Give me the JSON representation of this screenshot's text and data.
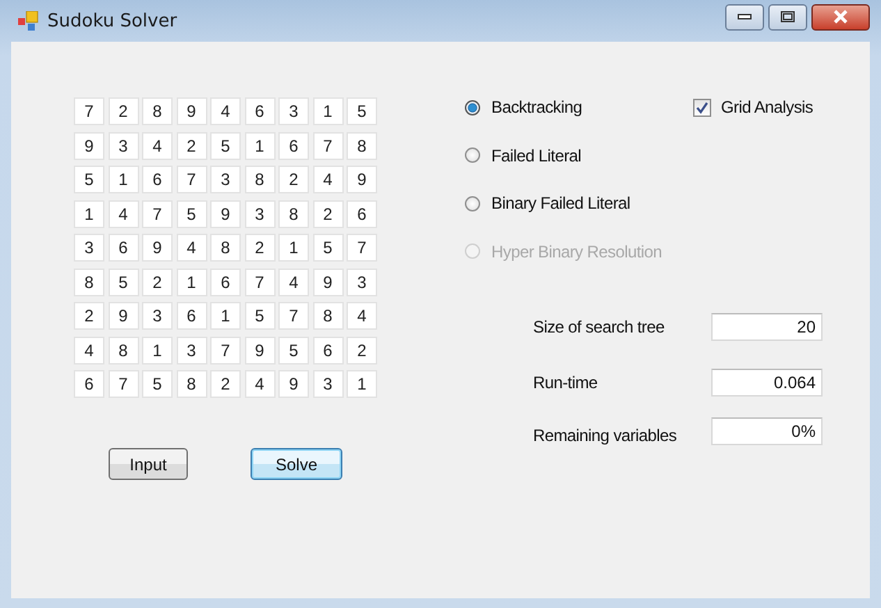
{
  "window": {
    "title": "Sudoku Solver"
  },
  "grid": [
    [
      "7",
      "2",
      "8",
      "9",
      "4",
      "6",
      "3",
      "1",
      "5"
    ],
    [
      "9",
      "3",
      "4",
      "2",
      "5",
      "1",
      "6",
      "7",
      "8"
    ],
    [
      "5",
      "1",
      "6",
      "7",
      "3",
      "8",
      "2",
      "4",
      "9"
    ],
    [
      "1",
      "4",
      "7",
      "5",
      "9",
      "3",
      "8",
      "2",
      "6"
    ],
    [
      "3",
      "6",
      "9",
      "4",
      "8",
      "2",
      "1",
      "5",
      "7"
    ],
    [
      "8",
      "5",
      "2",
      "1",
      "6",
      "7",
      "4",
      "9",
      "3"
    ],
    [
      "2",
      "9",
      "3",
      "6",
      "1",
      "5",
      "7",
      "8",
      "4"
    ],
    [
      "4",
      "8",
      "1",
      "3",
      "7",
      "9",
      "5",
      "6",
      "2"
    ],
    [
      "6",
      "7",
      "5",
      "8",
      "2",
      "4",
      "9",
      "3",
      "1"
    ]
  ],
  "buttons": [
    {
      "label": "Input",
      "focused": false
    },
    {
      "label": "Solve",
      "focused": true
    }
  ],
  "methods": [
    {
      "label": "Backtracking",
      "selected": true,
      "disabled": false
    },
    {
      "label": "Failed Literal",
      "selected": false,
      "disabled": false
    },
    {
      "label": "Binary Failed Literal",
      "selected": false,
      "disabled": false
    },
    {
      "label": "Hyper Binary Resolution",
      "selected": false,
      "disabled": true
    }
  ],
  "grid_analysis": {
    "label": "Grid Analysis",
    "checked": true
  },
  "stats": [
    {
      "label": "Size of search tree",
      "value": "20"
    },
    {
      "label": "Run-time",
      "value": "0.064"
    },
    {
      "label": "Remaining variables",
      "value": "0%"
    }
  ]
}
